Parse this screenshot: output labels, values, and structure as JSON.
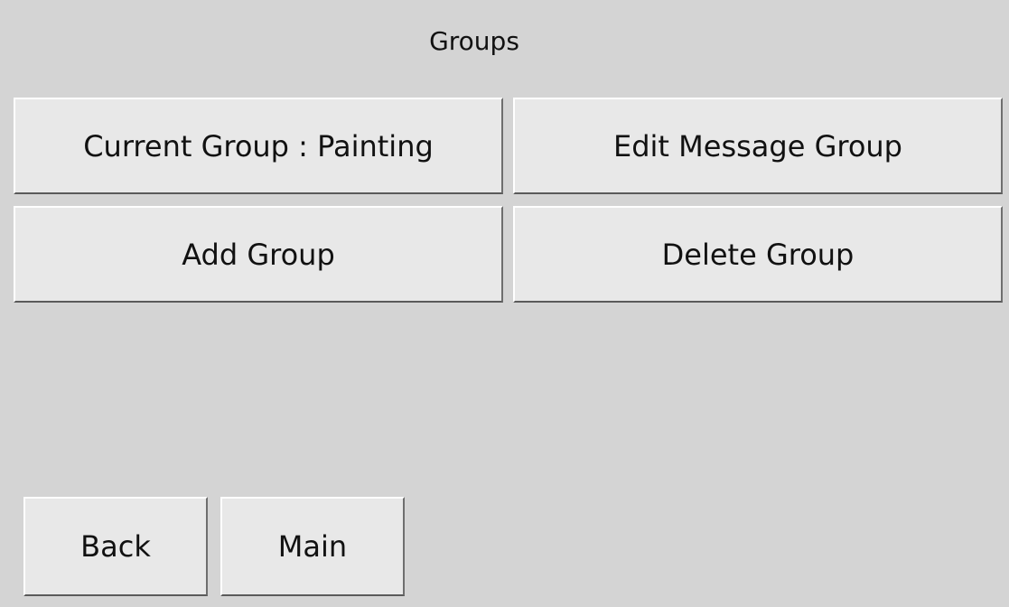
{
  "header": {
    "title": "Groups"
  },
  "actions": {
    "current_group_label": "Current Group : Painting",
    "edit_message_group_label": "Edit Message Group",
    "add_group_label": "Add Group",
    "delete_group_label": "Delete Group"
  },
  "navigation": {
    "back_label": "Back",
    "main_label": "Main"
  },
  "colors": {
    "background": "#d4d4d4",
    "button_face": "#e8e8e8",
    "text": "#111111"
  }
}
